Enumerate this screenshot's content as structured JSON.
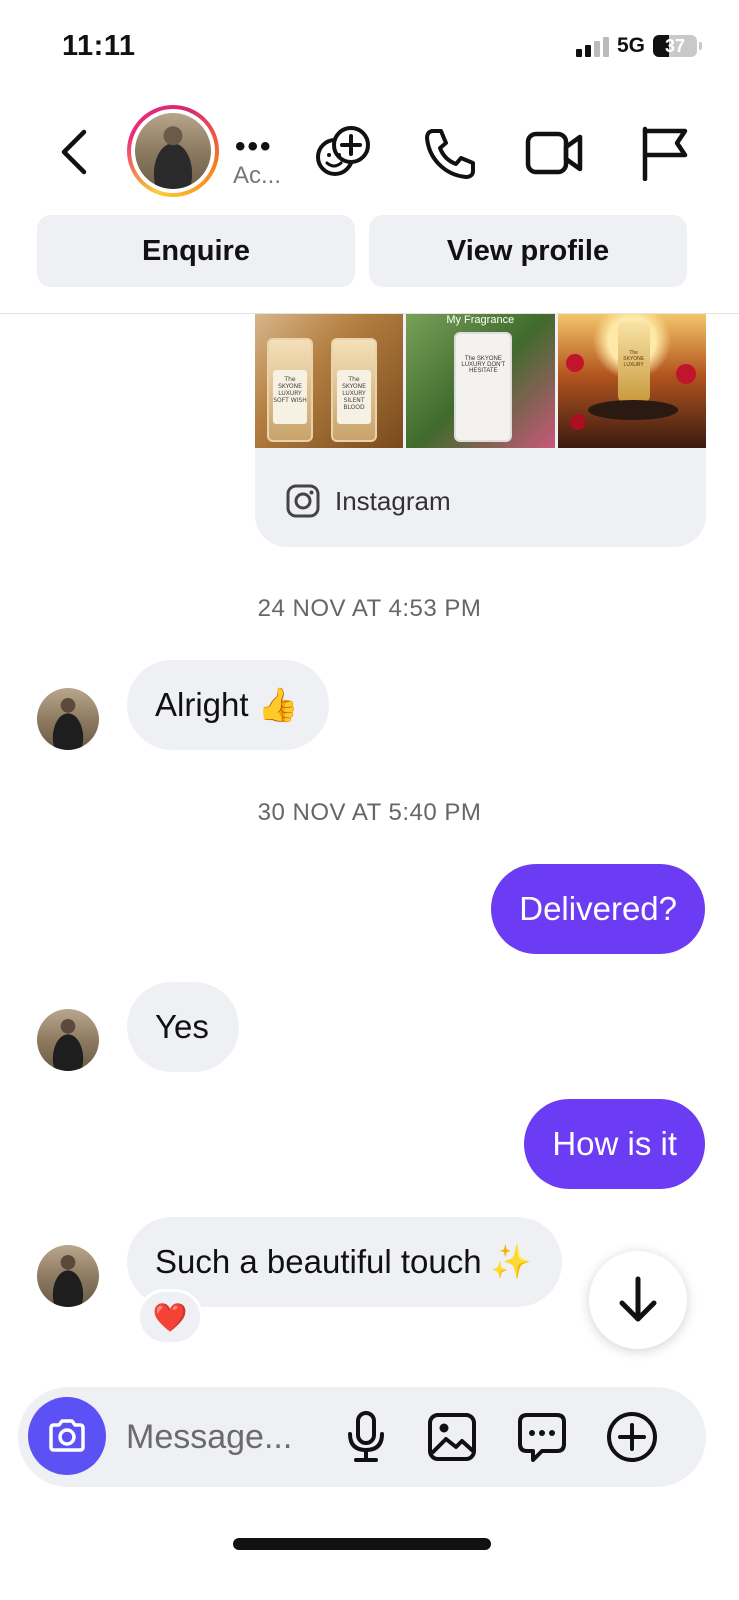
{
  "status_bar": {
    "time": "11:11",
    "network": "5G",
    "battery": "37"
  },
  "header": {
    "name": "•••",
    "subtitle": "Ac...",
    "icons": [
      "back-chevron-icon",
      "add-people-icon",
      "phone-icon",
      "video-camera-icon",
      "flag-icon"
    ]
  },
  "actions": {
    "enquire_label": "Enquire",
    "view_profile_label": "View profile"
  },
  "shared_post": {
    "source_label": "Instagram",
    "image_captions": [
      "The SKYONE LUXURY SOFT WISH",
      "The SKYONE LUXURY SILENT BLOOD",
      "My Fragrance",
      "The SKYONE LUXURY DON'T HESITATE",
      "The SKYONE LUXURY"
    ]
  },
  "thread": {
    "timestamp_1": "24 NOV AT 4:53 PM",
    "msg_alright": "Alright 👍",
    "timestamp_2": "30 NOV AT 5:40 PM",
    "msg_delivered": "Delivered?",
    "msg_yes": "Yes",
    "msg_how": "How is it",
    "msg_touch": "Such a beautiful touch ✨",
    "reaction": "❤️"
  },
  "composer": {
    "placeholder": "Message..."
  },
  "colors": {
    "outgoing_bubble": "#6c3cf5",
    "incoming_bubble": "#eef0f3",
    "camera_button": "#5b51f5"
  }
}
